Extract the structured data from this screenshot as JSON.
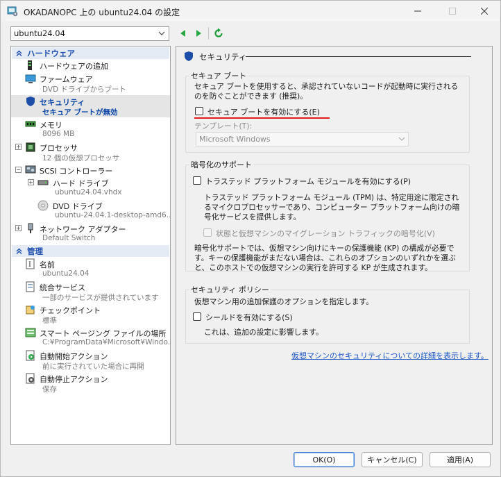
{
  "window": {
    "title": "OKADANOPC 上の ubuntu24.04 の設定",
    "minimize_label": "—",
    "maximize_label": "☐",
    "close_label": "✕"
  },
  "toolbar": {
    "vm_selected": "ubuntu24.04",
    "back_icon": "back-arrow-icon",
    "forward_icon": "forward-arrow-icon",
    "refresh_icon": "refresh-icon"
  },
  "tree": {
    "hardware_header": "ハードウェア",
    "management_header": "管理",
    "hardware_items": [
      {
        "label": "ハードウェアの追加",
        "sub": ""
      },
      {
        "label": "ファームウェア",
        "sub": "DVD ドライブからブート"
      },
      {
        "label": "セキュリティ",
        "sub": "セキュア ブートが無効"
      },
      {
        "label": "メモリ",
        "sub": "8096 MB"
      },
      {
        "label": "プロセッサ",
        "sub": "12 個の仮想プロセッサ"
      },
      {
        "label": "SCSI コントローラー",
        "sub": ""
      },
      {
        "label": "ハード ドライブ",
        "sub": "ubuntu24.04.vhdx"
      },
      {
        "label": "DVD ドライブ",
        "sub": "ubuntu-24.04.1-desktop-amd6..."
      },
      {
        "label": "ネットワーク アダプター",
        "sub": "Default Switch"
      }
    ],
    "management_items": [
      {
        "label": "名前",
        "sub": "ubuntu24.04"
      },
      {
        "label": "統合サービス",
        "sub": "一部のサービスが提供されています"
      },
      {
        "label": "チェックポイント",
        "sub": "標準"
      },
      {
        "label": "スマート ページング ファイルの場所",
        "sub": "C:¥ProgramData¥Microsoft¥Windo..."
      },
      {
        "label": "自動開始アクション",
        "sub": "前に実行されていた場合に再開"
      },
      {
        "label": "自動停止アクション",
        "sub": "保存"
      }
    ]
  },
  "security": {
    "heading": "セキュリティ",
    "secure_boot": {
      "group_title": "セキュア ブート",
      "description": "セキュア ブートを使用すると、承認されていないコードが起動時に実行されるのを防ぐことができます (推奨)。",
      "enable_label": "セキュア ブートを有効にする(E)",
      "enable_checked": false,
      "template_label": "テンプレート(T):",
      "template_value": "Microsoft Windows"
    },
    "encryption": {
      "group_title": "暗号化のサポート",
      "tpm_label": "トラステッド プラットフォーム モジュールを有効にする(P)",
      "tpm_checked": false,
      "tpm_description": "トラステッド プラットフォーム モジュール (TPM) は、特定用途に限定されるマイクロプロセッサーであり、コンピューター プラットフォーム向けの暗号化サービスを提供します。",
      "migration_label": "状態と仮想マシンのマイグレーション トラフィックの暗号化(V)",
      "key_protector_note": "暗号化サポートでは、仮想マシン向けにキーの保護機能 (KP) の構成が必要です。キーの保護機能がまだない場合は、これらのオプションのいずれかを選ぶと、このホストでの仮想マシンの実行を許可する KP が生成されます。"
    },
    "policy": {
      "group_title": "セキュリティ ポリシー",
      "description": "仮想マシン用の追加保護のオプションを指定します。",
      "shield_label": "シールドを有効にする(S)",
      "shield_checked": false,
      "shield_note": "これは、追加の設定に影響します。"
    },
    "details_link": "仮想マシンのセキュリティについての詳細を表示します。"
  },
  "buttons": {
    "ok": "OK(O)",
    "cancel": "キャンセル(C)",
    "apply": "適用(A)"
  },
  "colors": {
    "accent": "#1f4fb0",
    "selection_text": "#0b47a8",
    "highlight_underline": "#e21a1a",
    "link": "#1a55c5"
  }
}
